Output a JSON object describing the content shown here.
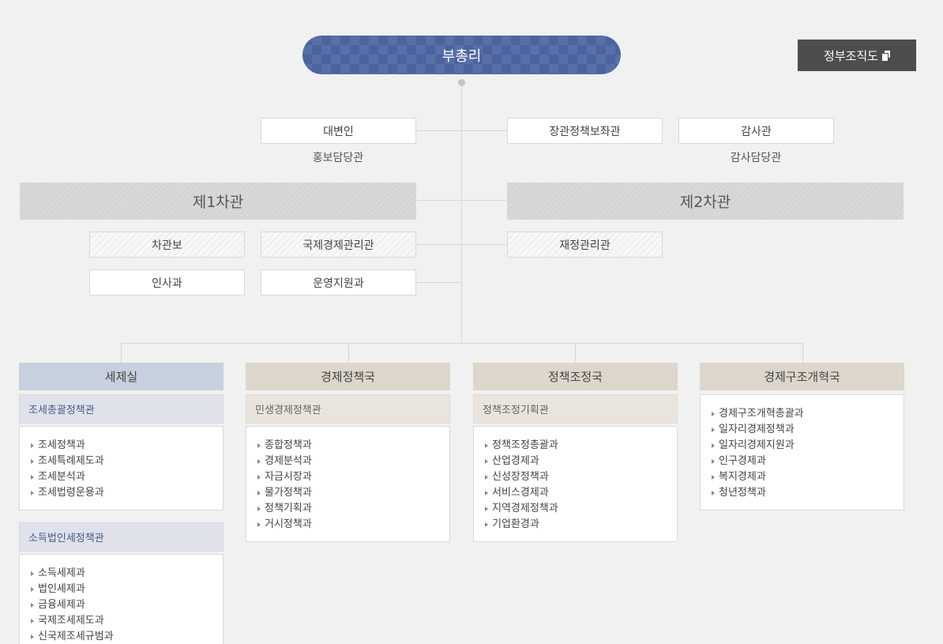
{
  "top": {
    "title": "부총리"
  },
  "gov_button": {
    "label": "정부조직도",
    "icon": "document-icon"
  },
  "staff": {
    "spokesperson": {
      "label": "대변인",
      "sub": "홍보담당관"
    },
    "minister_policy_aide": {
      "label": "장관정책보좌관"
    },
    "auditor": {
      "label": "감사관",
      "sub": "감사담당관"
    }
  },
  "vice1": {
    "title": "제1차관",
    "units": [
      "차관보",
      "국제경제관리관",
      "인사과",
      "운영지원과"
    ]
  },
  "vice2": {
    "title": "제2차관",
    "units": [
      "재정관리관"
    ]
  },
  "columns": [
    {
      "title": "세제실",
      "sections": [
        {
          "title": "조세총괄정책관",
          "items": [
            "조세정책과",
            "조세특례제도과",
            "조세분석과",
            "조세법령운용과"
          ]
        },
        {
          "title": "소득법인세정책관",
          "items": [
            "소득세제과",
            "법인세제과",
            "금융세제과",
            "국제조세제도과",
            "신국제조세규범과"
          ]
        }
      ]
    },
    {
      "title": "경제정책국",
      "sections": [
        {
          "title": "민생경제정책관",
          "items": [
            "종합정책과",
            "경제분석과",
            "자금시장과",
            "물가정책과",
            "정책기획과",
            "거시정책과"
          ]
        }
      ]
    },
    {
      "title": "정책조정국",
      "sections": [
        {
          "title": "정책조정기획관",
          "items": [
            "정책조정총괄과",
            "산업경제과",
            "신성장정책과",
            "서비스경제과",
            "지역경제정책과",
            "기업환경과"
          ]
        }
      ]
    },
    {
      "title": "경제구조개혁국",
      "sections": [
        {
          "title": "",
          "items": [
            "경제구조개혁총괄과",
            "일자리경제정책과",
            "일자리경제지원과",
            "인구경제과",
            "복지경제과",
            "청년정책과"
          ]
        }
      ]
    }
  ],
  "colors": {
    "top_node": "#4b64a0",
    "gov_button": "#4d4d4d",
    "col_blue": "#c7d0de",
    "col_beige": "#ddd6cb"
  }
}
